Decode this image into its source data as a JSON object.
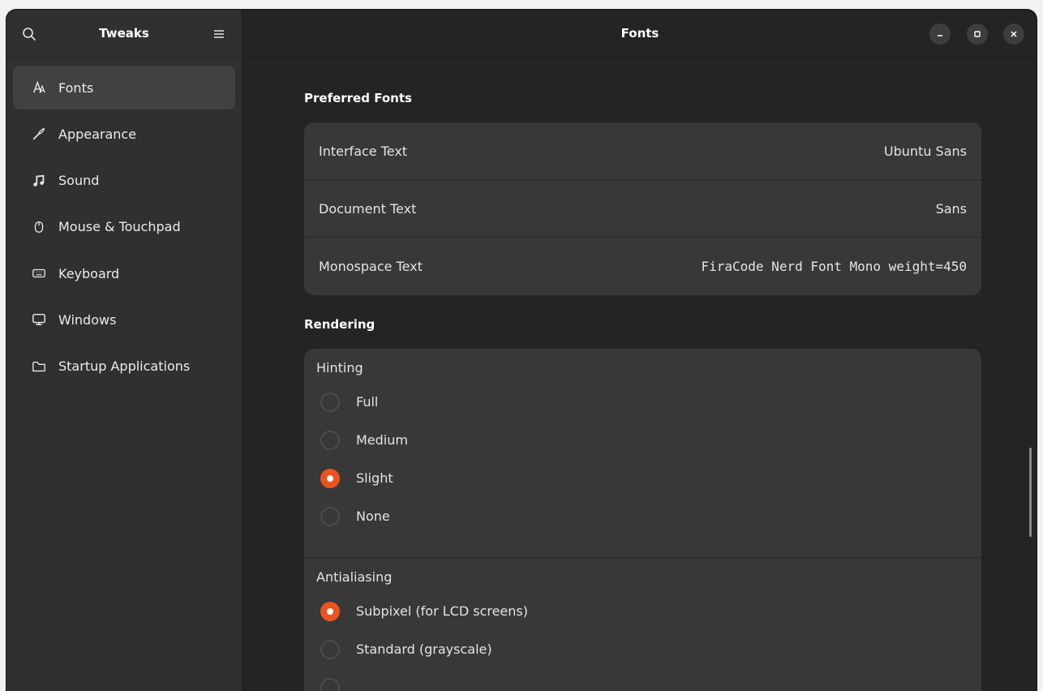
{
  "sidebar": {
    "title": "Tweaks",
    "items": [
      {
        "label": "Fonts",
        "icon": "fonts-icon"
      },
      {
        "label": "Appearance",
        "icon": "appearance-icon"
      },
      {
        "label": "Sound",
        "icon": "music-note-icon"
      },
      {
        "label": "Mouse & Touchpad",
        "icon": "mouse-icon"
      },
      {
        "label": "Keyboard",
        "icon": "keyboard-icon"
      },
      {
        "label": "Windows",
        "icon": "monitor-icon"
      },
      {
        "label": "Startup Applications",
        "icon": "folder-icon"
      }
    ]
  },
  "main": {
    "title": "Fonts",
    "preferred": {
      "title": "Preferred Fonts",
      "rows": [
        {
          "label": "Interface Text",
          "value": "Ubuntu Sans"
        },
        {
          "label": "Document Text",
          "value": "Sans"
        },
        {
          "label": "Monospace Text",
          "value": "FiraCode Nerd Font Mono weight=450"
        }
      ]
    },
    "rendering": {
      "title": "Rendering",
      "hinting": {
        "label": "Hinting",
        "options": [
          "Full",
          "Medium",
          "Slight",
          "None"
        ],
        "selected": "Slight"
      },
      "antialiasing": {
        "label": "Antialiasing",
        "options": [
          "Subpixel (for LCD screens)",
          "Standard (grayscale)"
        ],
        "selected": "Subpixel (for LCD screens)"
      }
    }
  },
  "colors": {
    "accent": "#e95420",
    "window_bg": "#242424",
    "sidebar_bg": "#303030",
    "card_bg": "#383838"
  }
}
